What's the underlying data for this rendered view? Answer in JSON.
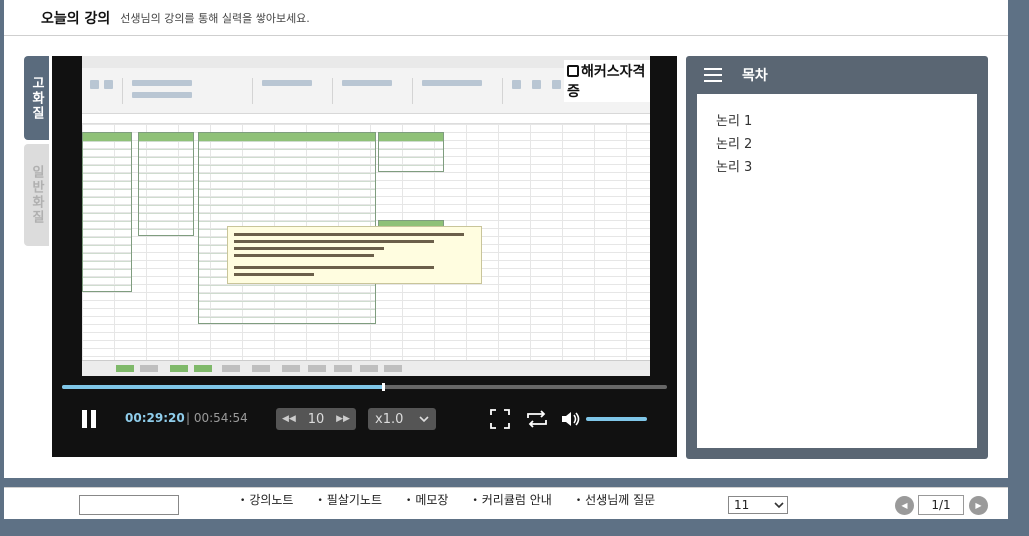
{
  "header": {
    "title": "오늘의 강의",
    "subtitle": "선생님의 강의를 통해 실력을 쌓아보세요."
  },
  "quality": {
    "hd_label": "고화질",
    "sd_label": "일반화질",
    "selected": "고화질"
  },
  "video": {
    "brand": "해커스자격증"
  },
  "player": {
    "current_time": "00:29:20",
    "total_time": "| 00:54:54",
    "progress_fraction": 0.53,
    "skip_seconds": "10",
    "speed": "x1.0",
    "volume_fraction": 1.0,
    "accent_color": "#7fc6e8"
  },
  "toc": {
    "title": "목차",
    "items": [
      "논리 1",
      "논리 2",
      "논리 3"
    ]
  },
  "bottom": {
    "links": [
      "강의노트",
      "필살기노트",
      "메모장",
      "커리큘럼 안내",
      "선생님께 질문"
    ],
    "select_value": "11",
    "page_indicator": "1/1"
  }
}
